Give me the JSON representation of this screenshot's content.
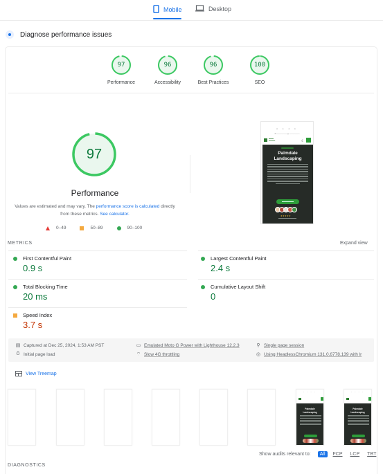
{
  "tabs": [
    {
      "label": "Mobile",
      "icon": "smartphone-icon",
      "active": true
    },
    {
      "label": "Desktop",
      "icon": "laptop-icon",
      "active": false
    }
  ],
  "diagnose": {
    "title": "Diagnose performance issues"
  },
  "categories": [
    {
      "label": "Performance",
      "score": "97"
    },
    {
      "label": "Accessibility",
      "score": "96"
    },
    {
      "label": "Best Practices",
      "score": "96"
    },
    {
      "label": "SEO",
      "score": "100"
    }
  ],
  "performance": {
    "score": "97",
    "title": "Performance",
    "note_prefix": "Values are estimated and may vary. The ",
    "note_link": "performance score is calculated",
    "note_middle": " directly from these metrics. ",
    "note_link2": "See calculator.",
    "legend": [
      {
        "range": "0–49",
        "shape": "triangle",
        "color": "#e53935"
      },
      {
        "range": "50–89",
        "shape": "square",
        "color": "#f4a93f"
      },
      {
        "range": "90–100",
        "shape": "circle",
        "color": "#34a853"
      }
    ],
    "score_color": "#0c7a3c",
    "ring_color": "#3cc862"
  },
  "preview": {
    "site_title_line1": "Palmdale",
    "site_title_line2": "Landscaping",
    "stars": "★★★★★"
  },
  "metrics": {
    "label": "METRICS",
    "expand": "Expand view",
    "items": [
      {
        "name": "First Contentful Paint",
        "value": "0.9 s",
        "status": "pass"
      },
      {
        "name": "Largest Contentful Paint",
        "value": "2.4 s",
        "status": "pass"
      },
      {
        "name": "Total Blocking Time",
        "value": "20 ms",
        "status": "pass"
      },
      {
        "name": "Cumulative Layout Shift",
        "value": "0",
        "status": "pass"
      },
      {
        "name": "Speed Index",
        "value": "3.7 s",
        "status": "average"
      }
    ]
  },
  "runtime": {
    "captured": "Captured at Dec 25, 2024, 1:53 AM PST",
    "load": "Initial page load",
    "device": "Emulated Moto G Power with Lighthouse 12.2.3",
    "throttling": "Slow 4G throttling",
    "session": "Single page session",
    "browser": "Using HeadlessChromium 131.0.6778.139 with lr"
  },
  "treemap": {
    "label": "View Treemap"
  },
  "filmstrip": {
    "frame_count": 8,
    "loaded_from_index": 6
  },
  "audit_filter": {
    "label": "Show audits relevant to:",
    "options": [
      "All",
      "FCP",
      "LCP",
      "TBT"
    ],
    "selected": "All"
  },
  "diagnostics": {
    "label": "DIAGNOSTICS"
  }
}
